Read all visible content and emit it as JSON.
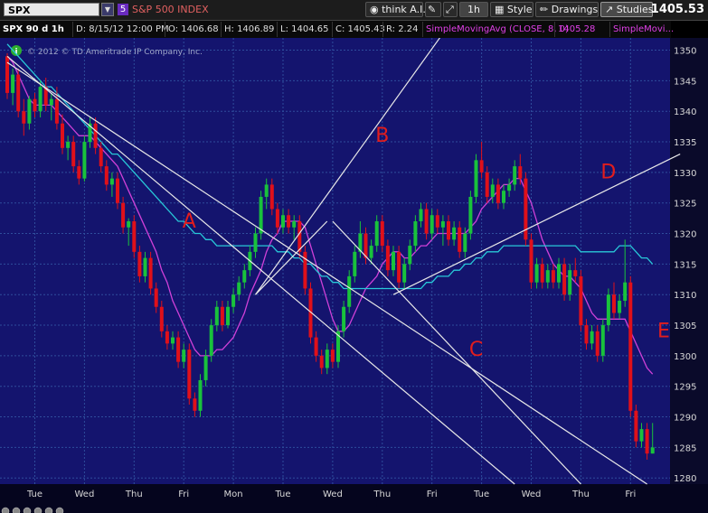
{
  "toolbar": {
    "symbol": "SPX",
    "badge": "5",
    "symbol_name": "S&P 500 INDEX",
    "think_label": "think A.I.",
    "period_label": "1h",
    "style_label": "Style",
    "drawings_label": "Drawings",
    "studies_label": "Studies",
    "last_price": "1405.53"
  },
  "info": {
    "title": "SPX 90 d 1h",
    "date": "D: 8/15/12 12:00 PM",
    "open": "O: 1406.68",
    "high": "H: 1406.89",
    "low": "L: 1404.65",
    "close": "C: 1405.43",
    "range": "R: 2.24",
    "study1": "SimpleMovingAvg (CLOSE, 8, 0)",
    "study1_value": "1405.28",
    "study2": "SimpleMovi..."
  },
  "copyright": "© 2012 © TD Ameritrade IP Company, Inc.",
  "colors": {
    "background": "#14146e",
    "grid": "#2e4d9c",
    "up_candle": "#19c23c",
    "down_candle": "#e0101a",
    "sma_short": "#d040d8",
    "sma_long": "#28c8d8",
    "trendline": "#e8e8e8",
    "annotation": "#e21d1d"
  },
  "chart_data": {
    "type": "candlestick",
    "title": "SPX 90 d 1h",
    "y_axis_side": "right",
    "ylim": [
      1279,
      1352
    ],
    "y_ticks": [
      1280,
      1285,
      1290,
      1295,
      1300,
      1305,
      1310,
      1315,
      1320,
      1325,
      1330,
      1335,
      1340,
      1345,
      1350
    ],
    "x_tick_labels": [
      "Tue",
      "Wed",
      "Thu",
      "Fri",
      "Mon",
      "Tue",
      "Wed",
      "Thu",
      "Fri",
      "Tue",
      "Wed",
      "Thu",
      "Fri"
    ],
    "x_tick_bar_index": [
      5,
      14,
      23,
      32,
      41,
      50,
      59,
      68,
      77,
      86,
      95,
      104,
      113
    ],
    "n_bars": 118,
    "grid": true,
    "candles": [
      [
        1349.0,
        1349.5,
        1342.0,
        1343.0
      ],
      [
        1343.0,
        1347.0,
        1341.0,
        1346.0
      ],
      [
        1346.0,
        1347.0,
        1339.0,
        1340.0
      ],
      [
        1340.0,
        1342.0,
        1336.0,
        1338.0
      ],
      [
        1338.0,
        1342.5,
        1337.0,
        1342.0
      ],
      [
        1342.0,
        1343.0,
        1339.0,
        1340.0
      ],
      [
        1340.0,
        1345.0,
        1339.0,
        1344.0
      ],
      [
        1344.0,
        1345.5,
        1340.0,
        1341.0
      ],
      [
        1341.0,
        1343.0,
        1338.5,
        1342.0
      ],
      [
        1342.0,
        1344.0,
        1337.0,
        1338.0
      ],
      [
        1338.0,
        1339.5,
        1333.0,
        1334.0
      ],
      [
        1334.0,
        1336.0,
        1332.0,
        1335.0
      ],
      [
        1335.0,
        1336.0,
        1330.0,
        1331.0
      ],
      [
        1331.0,
        1332.0,
        1328.0,
        1329.0
      ],
      [
        1329.0,
        1336.0,
        1328.5,
        1335.0
      ],
      [
        1335.0,
        1339.0,
        1334.0,
        1338.0
      ],
      [
        1338.0,
        1339.0,
        1333.0,
        1334.0
      ],
      [
        1334.0,
        1335.0,
        1330.0,
        1331.0
      ],
      [
        1331.0,
        1332.0,
        1327.0,
        1328.0
      ],
      [
        1328.0,
        1330.0,
        1326.0,
        1329.0
      ],
      [
        1329.0,
        1330.0,
        1324.0,
        1325.0
      ],
      [
        1325.0,
        1326.0,
        1320.0,
        1321.0
      ],
      [
        1321.0,
        1322.5,
        1318.0,
        1322.0
      ],
      [
        1322.0,
        1323.0,
        1316.0,
        1317.0
      ],
      [
        1317.0,
        1318.0,
        1312.0,
        1313.0
      ],
      [
        1313.0,
        1317.0,
        1312.0,
        1316.0
      ],
      [
        1316.0,
        1317.0,
        1310.0,
        1311.0
      ],
      [
        1311.0,
        1312.0,
        1307.0,
        1308.0
      ],
      [
        1308.0,
        1309.0,
        1303.0,
        1304.0
      ],
      [
        1304.0,
        1305.0,
        1301.0,
        1302.0
      ],
      [
        1302.0,
        1304.0,
        1301.0,
        1303.0
      ],
      [
        1303.0,
        1304.0,
        1298.0,
        1299.0
      ],
      [
        1299.0,
        1302.0,
        1298.0,
        1301.0
      ],
      [
        1301.0,
        1302.0,
        1292.0,
        1293.0
      ],
      [
        1293.0,
        1294.0,
        1290.0,
        1291.0
      ],
      [
        1291.0,
        1297.0,
        1290.0,
        1296.0
      ],
      [
        1296.0,
        1301.0,
        1295.0,
        1300.0
      ],
      [
        1300.0,
        1306.0,
        1299.0,
        1305.0
      ],
      [
        1305.0,
        1309.0,
        1304.0,
        1308.0
      ],
      [
        1308.0,
        1309.0,
        1304.0,
        1305.0
      ],
      [
        1305.0,
        1309.0,
        1304.5,
        1308.0
      ],
      [
        1308.0,
        1311.0,
        1307.0,
        1310.0
      ],
      [
        1310.0,
        1313.0,
        1309.0,
        1312.0
      ],
      [
        1312.0,
        1315.0,
        1311.0,
        1314.0
      ],
      [
        1314.0,
        1318.0,
        1313.0,
        1317.0
      ],
      [
        1317.0,
        1321.0,
        1316.0,
        1320.0
      ],
      [
        1320.0,
        1327.0,
        1319.0,
        1326.0
      ],
      [
        1326.0,
        1329.0,
        1324.0,
        1328.0
      ],
      [
        1328.0,
        1329.0,
        1323.0,
        1324.0
      ],
      [
        1324.0,
        1325.0,
        1320.0,
        1321.0
      ],
      [
        1321.0,
        1324.0,
        1320.0,
        1323.0
      ],
      [
        1323.0,
        1324.0,
        1320.0,
        1321.0
      ],
      [
        1321.0,
        1323.0,
        1319.0,
        1322.0
      ],
      [
        1322.0,
        1323.0,
        1316.0,
        1317.0
      ],
      [
        1317.0,
        1318.0,
        1310.0,
        1311.0
      ],
      [
        1311.0,
        1312.0,
        1302.0,
        1303.0
      ],
      [
        1303.0,
        1304.0,
        1299.0,
        1300.0
      ],
      [
        1300.0,
        1301.0,
        1297.0,
        1298.0
      ],
      [
        1298.0,
        1302.0,
        1297.0,
        1301.0
      ],
      [
        1301.0,
        1302.0,
        1298.0,
        1299.0
      ],
      [
        1299.0,
        1305.0,
        1298.0,
        1304.0
      ],
      [
        1304.0,
        1309.0,
        1303.0,
        1308.0
      ],
      [
        1308.0,
        1314.0,
        1307.0,
        1313.0
      ],
      [
        1313.0,
        1318.0,
        1312.0,
        1317.0
      ],
      [
        1317.0,
        1322.0,
        1316.0,
        1320.0
      ],
      [
        1320.0,
        1321.0,
        1315.0,
        1316.0
      ],
      [
        1316.0,
        1319.0,
        1315.0,
        1318.0
      ],
      [
        1318.0,
        1323.0,
        1317.0,
        1322.0
      ],
      [
        1322.0,
        1323.0,
        1317.0,
        1318.0
      ],
      [
        1318.0,
        1319.0,
        1313.0,
        1314.0
      ],
      [
        1314.0,
        1318.0,
        1313.0,
        1317.0
      ],
      [
        1317.0,
        1318.0,
        1311.0,
        1312.0
      ],
      [
        1312.0,
        1316.0,
        1311.0,
        1315.0
      ],
      [
        1315.0,
        1319.0,
        1314.0,
        1318.0
      ],
      [
        1318.0,
        1323.0,
        1317.0,
        1322.0
      ],
      [
        1322.0,
        1325.0,
        1321.0,
        1324.0
      ],
      [
        1324.0,
        1325.0,
        1319.0,
        1320.0
      ],
      [
        1320.0,
        1324.0,
        1319.0,
        1323.0
      ],
      [
        1323.0,
        1324.0,
        1320.0,
        1321.0
      ],
      [
        1321.0,
        1323.0,
        1318.0,
        1322.0
      ],
      [
        1322.0,
        1323.0,
        1318.0,
        1319.0
      ],
      [
        1319.0,
        1322.0,
        1318.0,
        1321.0
      ],
      [
        1321.0,
        1322.0,
        1316.0,
        1317.0
      ],
      [
        1317.0,
        1321.0,
        1316.0,
        1320.0
      ],
      [
        1320.0,
        1327.0,
        1319.0,
        1326.0
      ],
      [
        1326.0,
        1333.0,
        1325.0,
        1332.0
      ],
      [
        1332.0,
        1335.0,
        1329.0,
        1330.0
      ],
      [
        1330.0,
        1331.0,
        1325.0,
        1326.0
      ],
      [
        1326.0,
        1329.0,
        1325.0,
        1328.0
      ],
      [
        1328.0,
        1329.0,
        1324.0,
        1325.0
      ],
      [
        1325.0,
        1328.0,
        1324.0,
        1327.0
      ],
      [
        1327.0,
        1329.0,
        1326.0,
        1328.0
      ],
      [
        1328.0,
        1332.0,
        1327.0,
        1331.0
      ],
      [
        1331.0,
        1333.0,
        1328.0,
        1329.0
      ],
      [
        1329.0,
        1330.0,
        1318.0,
        1319.0
      ],
      [
        1319.0,
        1320.0,
        1311.0,
        1312.0
      ],
      [
        1312.0,
        1316.0,
        1311.0,
        1315.0
      ],
      [
        1315.0,
        1316.0,
        1311.0,
        1312.0
      ],
      [
        1312.0,
        1315.0,
        1311.0,
        1314.0
      ],
      [
        1314.0,
        1315.0,
        1311.0,
        1312.0
      ],
      [
        1312.0,
        1316.0,
        1311.0,
        1315.0
      ],
      [
        1315.0,
        1316.0,
        1309.0,
        1310.0
      ],
      [
        1310.0,
        1315.0,
        1309.0,
        1314.0
      ],
      [
        1314.0,
        1316.0,
        1312.0,
        1313.0
      ],
      [
        1313.0,
        1314.0,
        1304.0,
        1305.0
      ],
      [
        1305.0,
        1306.0,
        1301.0,
        1302.0
      ],
      [
        1302.0,
        1305.0,
        1301.0,
        1304.0
      ],
      [
        1304.0,
        1305.0,
        1299.0,
        1300.0
      ],
      [
        1300.0,
        1306.0,
        1299.0,
        1305.0
      ],
      [
        1305.0,
        1311.0,
        1304.0,
        1310.0
      ],
      [
        1310.0,
        1312.0,
        1306.0,
        1307.0
      ],
      [
        1307.0,
        1310.0,
        1306.0,
        1309.0
      ],
      [
        1309.0,
        1319.0,
        1308.0,
        1312.0
      ],
      [
        1312.0,
        1313.0,
        1290.0,
        1291.0
      ],
      [
        1291.0,
        1292.0,
        1285.0,
        1286.0
      ],
      [
        1286.0,
        1289.0,
        1285.0,
        1288.0
      ],
      [
        1288.0,
        1289.0,
        1283.0,
        1284.0
      ],
      [
        1284.0,
        1289.0,
        1284.0,
        1285.0
      ]
    ],
    "series": [
      {
        "name": "SimpleMovingAvg (CLOSE, 8, 0)",
        "color": "#d040d8",
        "values": [
          1349,
          1348,
          1346,
          1344,
          1342,
          1341,
          1341,
          1341,
          1341,
          1340,
          1339,
          1338,
          1337,
          1336,
          1336,
          1336,
          1335,
          1334,
          1333,
          1332,
          1331,
          1329,
          1327,
          1325,
          1323,
          1321,
          1319,
          1317,
          1314,
          1312,
          1309,
          1307,
          1305,
          1303,
          1301,
          1300,
          1300,
          1300,
          1301,
          1301,
          1302,
          1303,
          1305,
          1307,
          1310,
          1312,
          1314,
          1317,
          1319,
          1320,
          1322,
          1322,
          1322,
          1322,
          1321,
          1318,
          1315,
          1312,
          1309,
          1306,
          1304,
          1304,
          1305,
          1307,
          1309,
          1311,
          1312,
          1313,
          1315,
          1316,
          1317,
          1317,
          1316,
          1316,
          1317,
          1318,
          1318,
          1319,
          1320,
          1320,
          1320,
          1320,
          1320,
          1320,
          1321,
          1322,
          1324,
          1325,
          1326,
          1327,
          1328,
          1328,
          1329,
          1329,
          1327,
          1325,
          1322,
          1319,
          1317,
          1315,
          1314,
          1313,
          1313,
          1312,
          1311,
          1309,
          1307,
          1306,
          1306,
          1306,
          1306,
          1306,
          1306,
          1304,
          1302,
          1300,
          1298,
          1297
        ]
      },
      {
        "name": "SimpleMovi...",
        "color": "#28c8d8",
        "values": [
          1351,
          1350,
          1349,
          1348,
          1347,
          1346,
          1345,
          1344,
          1344,
          1343,
          1342,
          1341,
          1340,
          1339,
          1338,
          1337,
          1336,
          1335,
          1334,
          1333,
          1333,
          1332,
          1331,
          1330,
          1329,
          1328,
          1327,
          1326,
          1325,
          1324,
          1323,
          1322,
          1322,
          1321,
          1320,
          1320,
          1319,
          1319,
          1318,
          1318,
          1318,
          1318,
          1318,
          1318,
          1318,
          1318,
          1318,
          1318,
          1318,
          1317,
          1317,
          1317,
          1316,
          1316,
          1315,
          1315,
          1314,
          1313,
          1313,
          1312,
          1312,
          1311,
          1311,
          1311,
          1311,
          1311,
          1311,
          1311,
          1311,
          1311,
          1311,
          1311,
          1311,
          1311,
          1311,
          1311,
          1312,
          1312,
          1313,
          1313,
          1313,
          1314,
          1314,
          1315,
          1315,
          1316,
          1316,
          1317,
          1317,
          1317,
          1318,
          1318,
          1318,
          1318,
          1318,
          1318,
          1318,
          1318,
          1318,
          1318,
          1318,
          1318,
          1318,
          1318,
          1317,
          1317,
          1317,
          1317,
          1317,
          1317,
          1317,
          1318,
          1318,
          1318,
          1317,
          1316,
          1316,
          1315
        ]
      }
    ],
    "trendlines": [
      {
        "from": [
          0,
          1349
        ],
        "to": [
          92,
          1279
        ]
      },
      {
        "from": [
          0,
          1348
        ],
        "to": [
          116,
          1279
        ]
      },
      {
        "from": [
          45,
          1310
        ],
        "to": [
          58,
          1322
        ]
      },
      {
        "from": [
          45,
          1310
        ],
        "to": [
          80,
          1354
        ]
      },
      {
        "from": [
          59,
          1322
        ],
        "to": [
          104,
          1279
        ]
      },
      {
        "from": [
          70,
          1310
        ],
        "to": [
          122,
          1333
        ]
      }
    ],
    "annotations": [
      {
        "text": "A",
        "x": 33,
        "y": 1321
      },
      {
        "text": "B",
        "x": 68,
        "y": 1335
      },
      {
        "text": "C",
        "x": 85,
        "y": 1300
      },
      {
        "text": "D",
        "x": 109,
        "y": 1329
      },
      {
        "text": "E",
        "x": 119,
        "y": 1303
      }
    ]
  }
}
